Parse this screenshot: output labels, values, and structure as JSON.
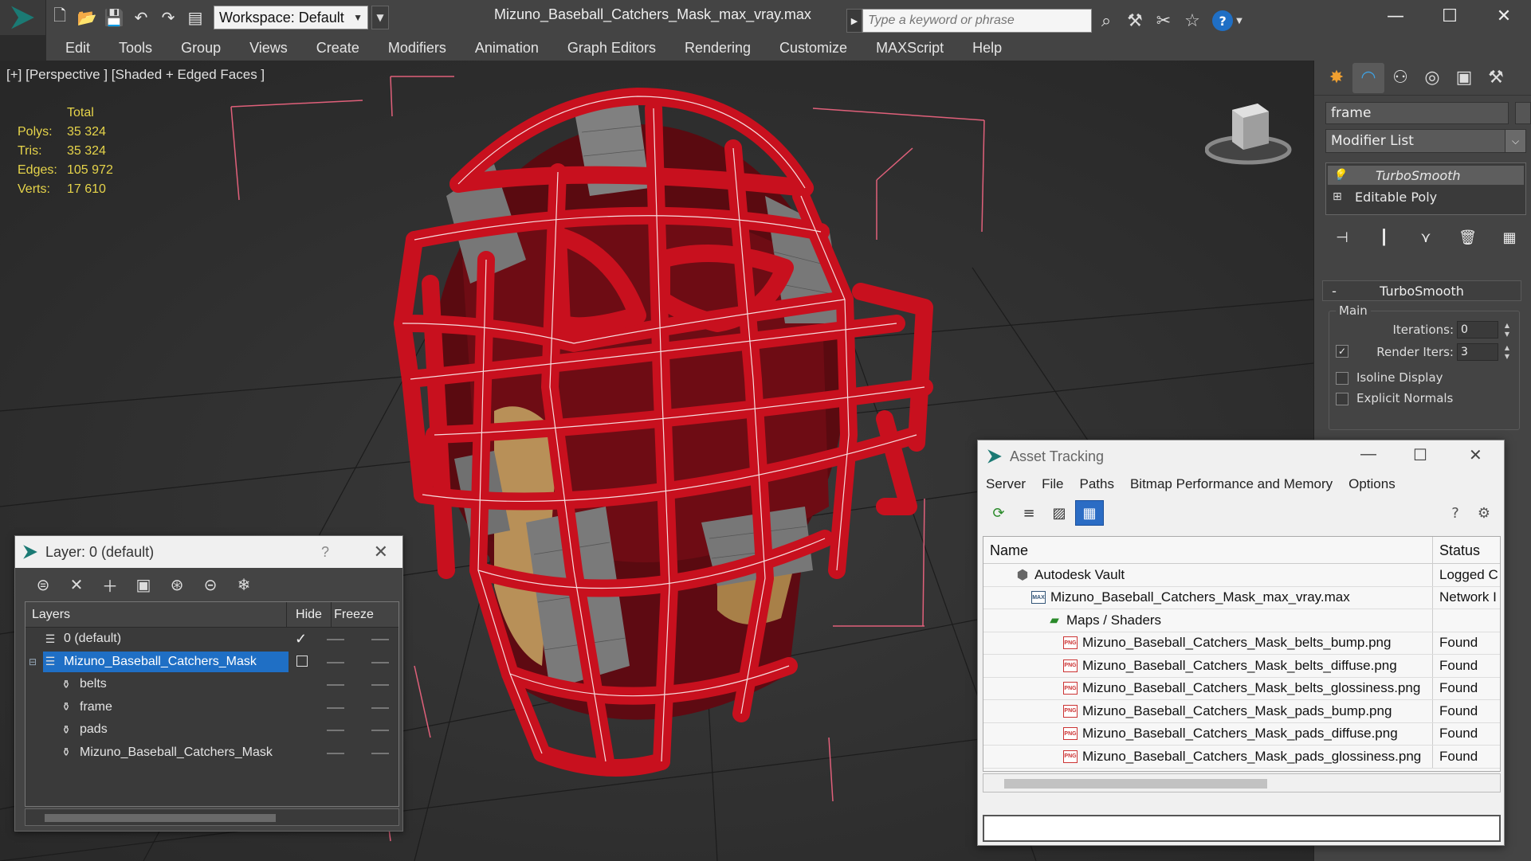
{
  "app": {
    "document_title": "Mizuno_Baseball_Catchers_Mask_max_vray.max",
    "workspace_label": "Workspace: Default",
    "search_placeholder": "Type a keyword or phrase"
  },
  "menu": [
    "Edit",
    "Tools",
    "Group",
    "Views",
    "Create",
    "Modifiers",
    "Animation",
    "Graph Editors",
    "Rendering",
    "Customize",
    "MAXScript",
    "Help"
  ],
  "viewport": {
    "label": "[+] [Perspective ] [Shaded + Edged Faces ]",
    "stats_header": "Total",
    "stats": [
      {
        "key": "Polys:",
        "value": "35 324"
      },
      {
        "key": "Tris:",
        "value": "35 324"
      },
      {
        "key": "Edges:",
        "value": "105 972"
      },
      {
        "key": "Verts:",
        "value": "17 610"
      }
    ]
  },
  "command_panel": {
    "object_name": "frame",
    "modifier_list_label": "Modifier List",
    "stack": [
      "TurboSmooth",
      "Editable Poly"
    ],
    "rollout_title": "TurboSmooth",
    "group_label": "Main",
    "iterations_label": "Iterations:",
    "iterations_value": "0",
    "render_iters_label": "Render Iters:",
    "render_iters_value": "3",
    "isoline_label": "Isoline Display",
    "explicit_normals_label": "Explicit Normals"
  },
  "layer_dialog": {
    "title": "Layer: 0 (default)",
    "help": "?",
    "col_layers": "Layers",
    "col_hide": "Hide",
    "col_freeze": "Freeze",
    "rows": [
      {
        "name": "0 (default)",
        "indent": 0
      },
      {
        "name": "Mizuno_Baseball_Catchers_Mask",
        "indent": 0
      },
      {
        "name": "belts",
        "indent": 1
      },
      {
        "name": "frame",
        "indent": 1
      },
      {
        "name": "pads",
        "indent": 1
      },
      {
        "name": "Mizuno_Baseball_Catchers_Mask",
        "indent": 1
      }
    ]
  },
  "asset_dialog": {
    "title": "Asset Tracking",
    "menu": [
      "Server",
      "File",
      "Paths",
      "Bitmap Performance and Memory",
      "Options"
    ],
    "col_name": "Name",
    "col_status": "Status",
    "rows": [
      {
        "name": "Autodesk Vault",
        "status": "Logged C",
        "icon": "vault",
        "indent": 1
      },
      {
        "name": "Mizuno_Baseball_Catchers_Mask_max_vray.max",
        "status": "Network I",
        "icon": "max",
        "indent": 2
      },
      {
        "name": "Maps / Shaders",
        "status": "",
        "icon": "maps",
        "indent": 3
      },
      {
        "name": "Mizuno_Baseball_Catchers_Mask_belts_bump.png",
        "status": "Found",
        "icon": "png",
        "indent": 4
      },
      {
        "name": "Mizuno_Baseball_Catchers_Mask_belts_diffuse.png",
        "status": "Found",
        "icon": "png",
        "indent": 4
      },
      {
        "name": "Mizuno_Baseball_Catchers_Mask_belts_glossiness.png",
        "status": "Found",
        "icon": "png",
        "indent": 4
      },
      {
        "name": "Mizuno_Baseball_Catchers_Mask_pads_bump.png",
        "status": "Found",
        "icon": "png",
        "indent": 4
      },
      {
        "name": "Mizuno_Baseball_Catchers_Mask_pads_diffuse.png",
        "status": "Found",
        "icon": "png",
        "indent": 4
      },
      {
        "name": "Mizuno_Baseball_Catchers_Mask_pads_glossiness.png",
        "status": "Found",
        "icon": "png",
        "indent": 4
      }
    ]
  },
  "colors": {
    "accent_blue": "#1f6fc5",
    "frame_red": "#c8101e",
    "stats_yellow": "#e6d44a",
    "bbox_pink": "#e0607a"
  }
}
